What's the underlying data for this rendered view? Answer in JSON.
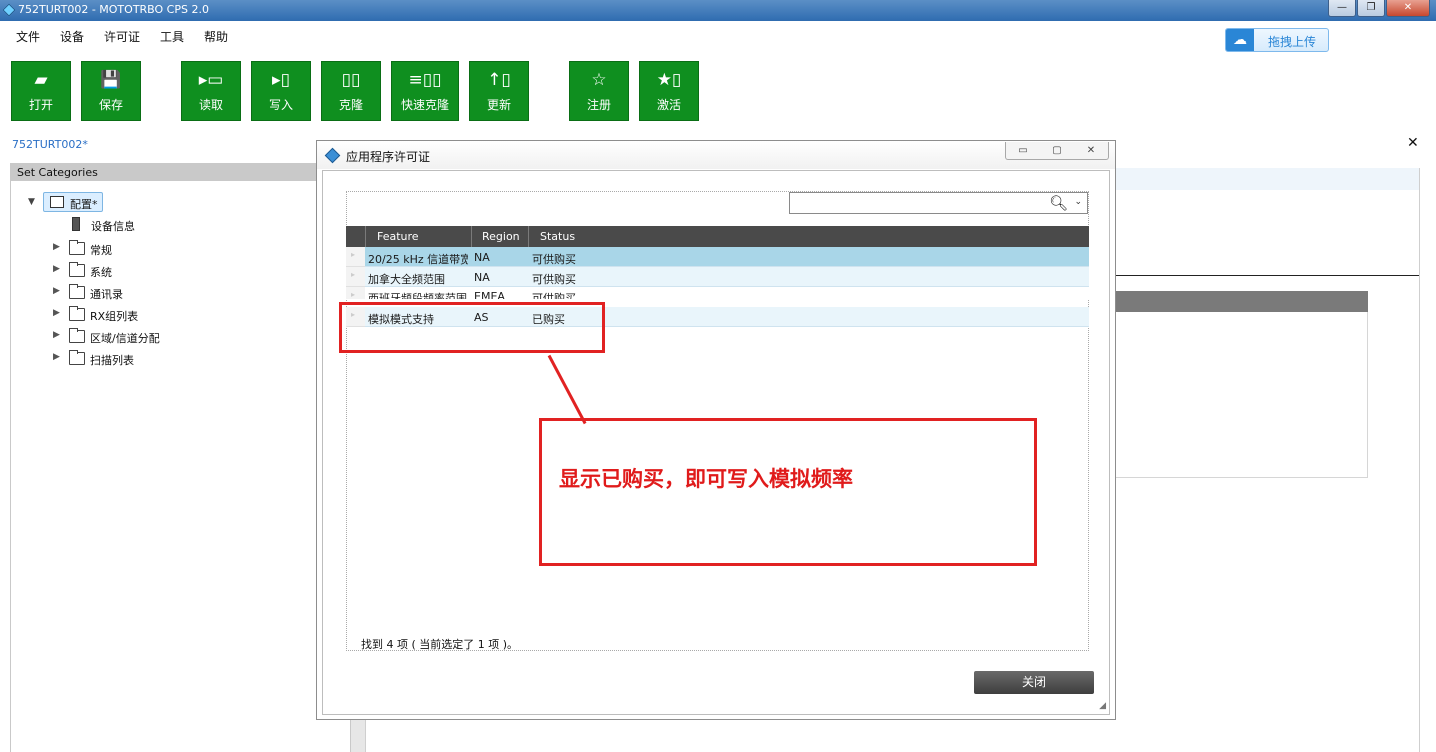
{
  "window": {
    "title": "752TURT002 - MOTOTRBO CPS 2.0",
    "min": "—",
    "max": "❐",
    "close": "✕"
  },
  "menu": [
    "文件",
    "设备",
    "许可证",
    "工具",
    "帮助"
  ],
  "upload": {
    "label": "拖拽上传",
    "icon": "cloud-icon"
  },
  "toolbar": [
    {
      "label": "打开",
      "icon": "▰"
    },
    {
      "label": "保存",
      "icon": "💾"
    },
    {
      "label": "读取",
      "icon": "▸▭"
    },
    {
      "label": "写入",
      "icon": "▸▯"
    },
    {
      "label": "克隆",
      "icon": "▯▯"
    },
    {
      "label": "快速克隆",
      "icon": "≡▯▯"
    },
    {
      "label": "更新",
      "icon": "↑▯"
    },
    {
      "label": "注册",
      "icon": "☆"
    },
    {
      "label": "激活",
      "icon": "★▯"
    }
  ],
  "doc_tab": "752TURT002*",
  "doc_close": "✕",
  "left_panel": {
    "header": "Set Categories",
    "root": "配置*",
    "device_info": "设备信息",
    "items": [
      "常规",
      "系统",
      "通讯录",
      "RX组列表",
      "区域/信道分配",
      "扫描列表"
    ]
  },
  "dialog": {
    "title": "应用程序许可证",
    "btns": [
      "▭",
      "▢",
      "✕"
    ],
    "search_placeholder": "",
    "columns": [
      "Feature",
      "Region",
      "Status"
    ],
    "rows": [
      {
        "feature": "20/25 kHz 信道带宽",
        "region": "NA",
        "status": "可供购买"
      },
      {
        "feature": "加拿大全频范围",
        "region": "NA",
        "status": "可供购买"
      },
      {
        "feature": "西班牙频段频率范围",
        "region": "EMEA",
        "status": "可供购买"
      },
      {
        "feature": "模拟模式支持",
        "region": "AS",
        "status": "已购买"
      }
    ],
    "status_line": "找到 4 项 ( 当前选定了 1 项 )。",
    "close_label": "关闭"
  },
  "annotation": "显示已购买，即可写入模拟频率",
  "colors": {
    "toolbar_green": "#0f8f1f",
    "annotation_red": "#e12222",
    "grid_header": "#4a4a4a"
  }
}
